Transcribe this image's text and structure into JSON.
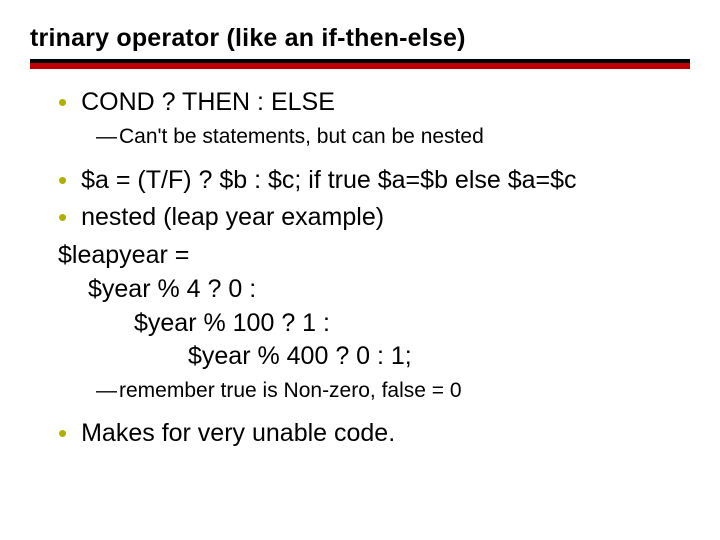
{
  "title": "trinary operator (like an if-then-else)",
  "bullets": {
    "b1": "COND ? THEN : ELSE",
    "b1sub": "Can't be statements, but can be nested",
    "b2": "$a = (T/F) ? $b : $c;  if true $a=$b else $a=$c",
    "b3": "nested (leap year example)",
    "code1": "$leapyear =",
    "code2": "$year % 4 ? 0 :",
    "code3": "$year % 100 ? 1 :",
    "code4": "$year % 400 ? 0 : 1;",
    "b3sub": "remember true is Non-zero, false = 0",
    "b4": "Makes for very unable code."
  }
}
